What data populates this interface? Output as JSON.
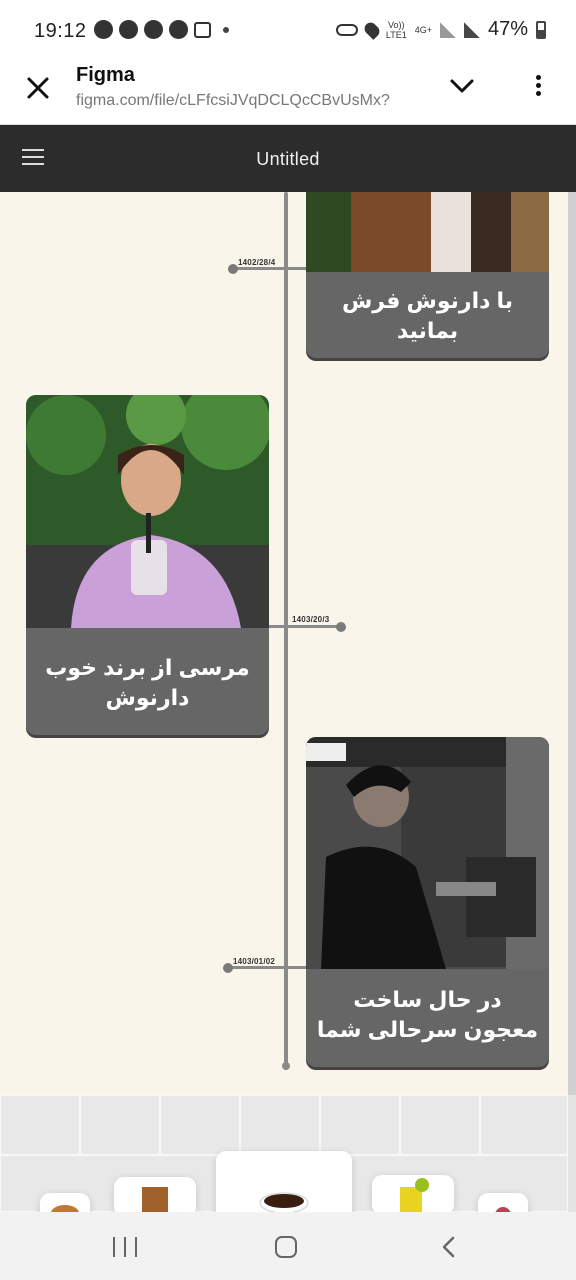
{
  "status_bar": {
    "time": "19:12",
    "network_top": "Vo))",
    "network_bottom": "LTE1",
    "network_type": "4G+",
    "battery": "47%",
    "left_icons": [
      "chat-icon",
      "whatsapp-icon",
      "facebook-icon",
      "facebook-icon",
      "app-icon"
    ],
    "right_icons": [
      "vpn-key-icon",
      "location-icon",
      "signal-icon",
      "signal-icon",
      "battery-icon"
    ]
  },
  "app_bar": {
    "title": "Figma",
    "url": "figma.com/file/cLFfcsiJVqDCLQcCBvUsMx?"
  },
  "figma": {
    "document_title": "Untitled"
  },
  "timeline": {
    "items": [
      {
        "date": "1402/28/4",
        "caption": "با دارنوش فرش بمانید",
        "side": "right"
      },
      {
        "date": "1403/20/3",
        "caption": "مرسی از برند خوب دارنوش",
        "side": "left"
      },
      {
        "date": "1403/01/02",
        "caption": "در حال ساخت معجون سرحالی شما",
        "side": "right"
      }
    ]
  },
  "colors": {
    "frame_bg": "#faf5ea",
    "card_bg": "#666666",
    "timeline": "#8a8a8a",
    "toolbar": "#2c2c2c"
  }
}
